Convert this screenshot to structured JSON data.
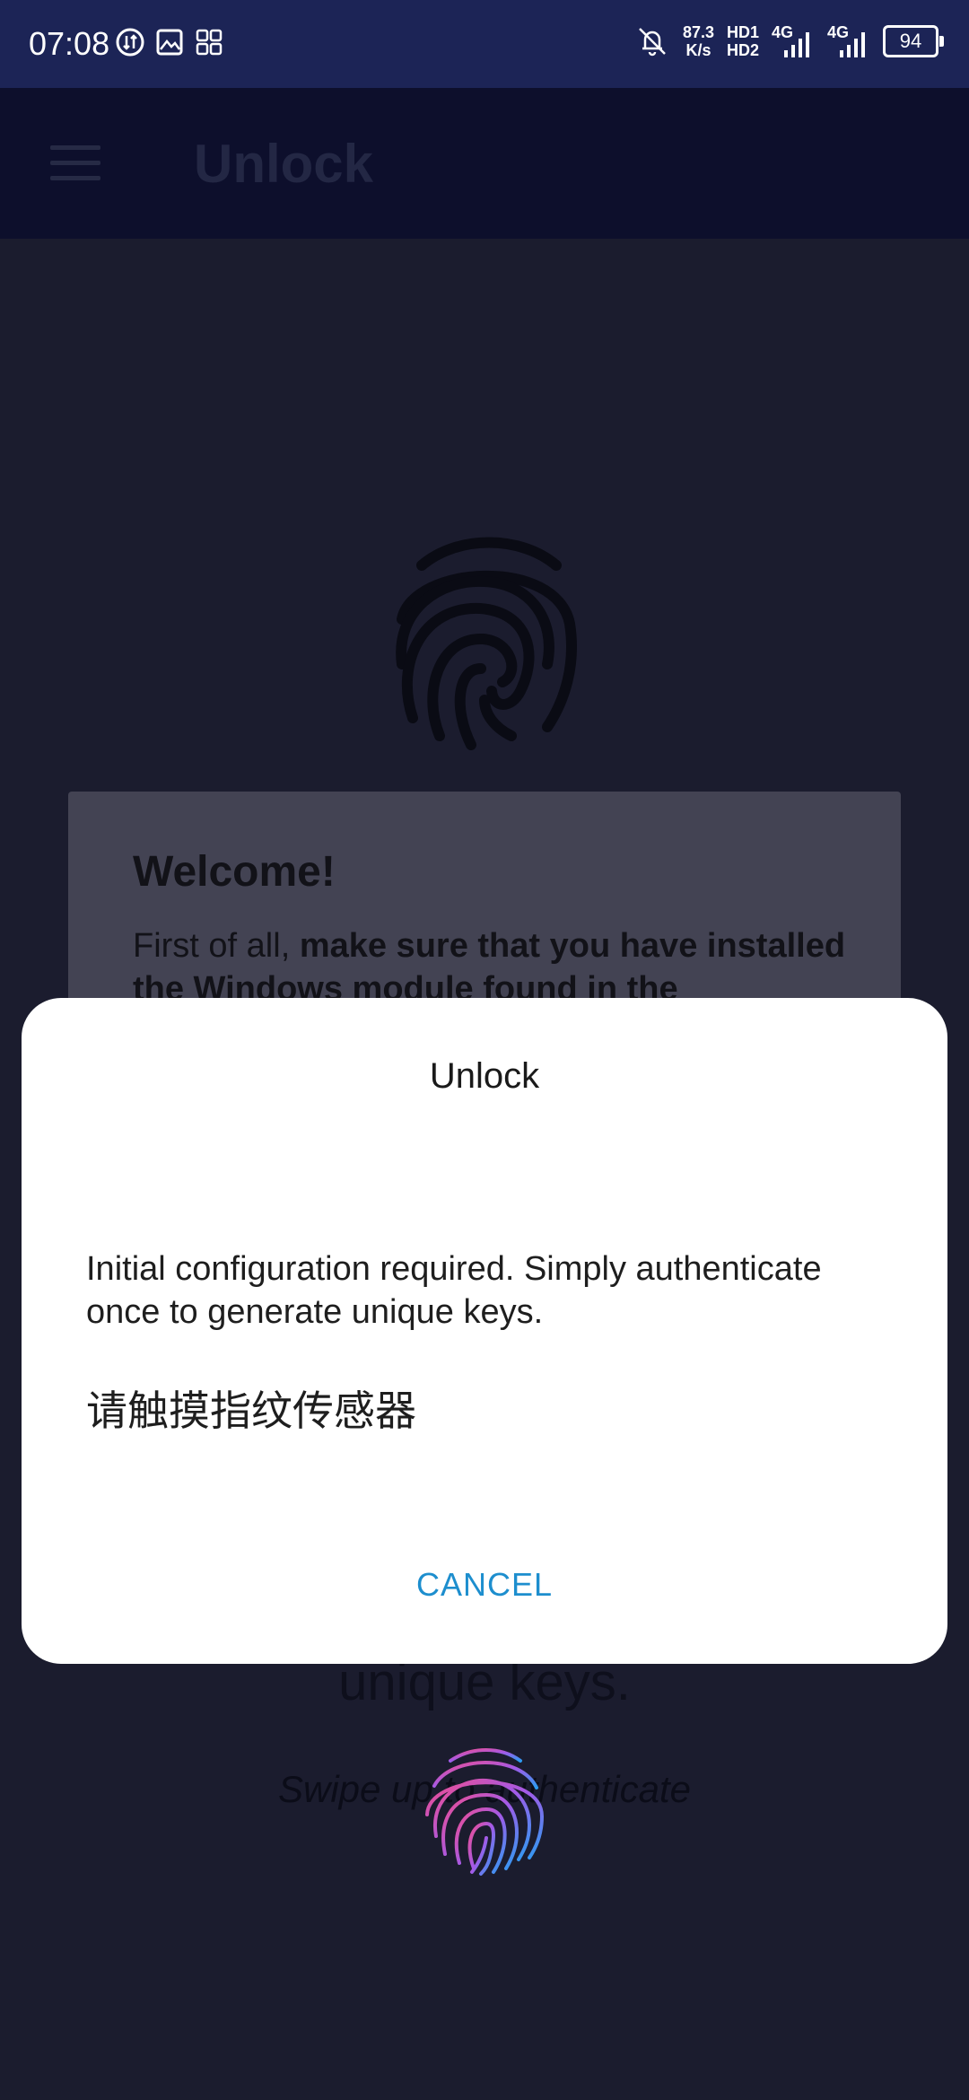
{
  "status_bar": {
    "time": "07:08",
    "net_speed_value": "87.3",
    "net_speed_unit": "K/s",
    "hd1": "HD1",
    "hd2": "HD2",
    "network1": "4G",
    "network2": "4G",
    "battery": "94"
  },
  "app_bar": {
    "title": "Unlock"
  },
  "welcome_card": {
    "title": "Welcome!",
    "text_plain": "First of all, ",
    "text_bold": "make sure that you have installed the Windows module found in the"
  },
  "background": {
    "unique_keys": "unique keys.",
    "swipe_text": "Swipe up to authenticate"
  },
  "dialog": {
    "title": "Unlock",
    "message": "Initial configuration required. Simply authenticate once to generate unique keys.",
    "hint": "请触摸指纹传感器",
    "cancel_label": "CANCEL"
  },
  "colors": {
    "status_bar_bg": "#1c2456",
    "app_bar_bg": "#0d0f2c",
    "background": "#1b1c2e",
    "dialog_bg": "#ffffff",
    "accent": "#1d8ece"
  }
}
